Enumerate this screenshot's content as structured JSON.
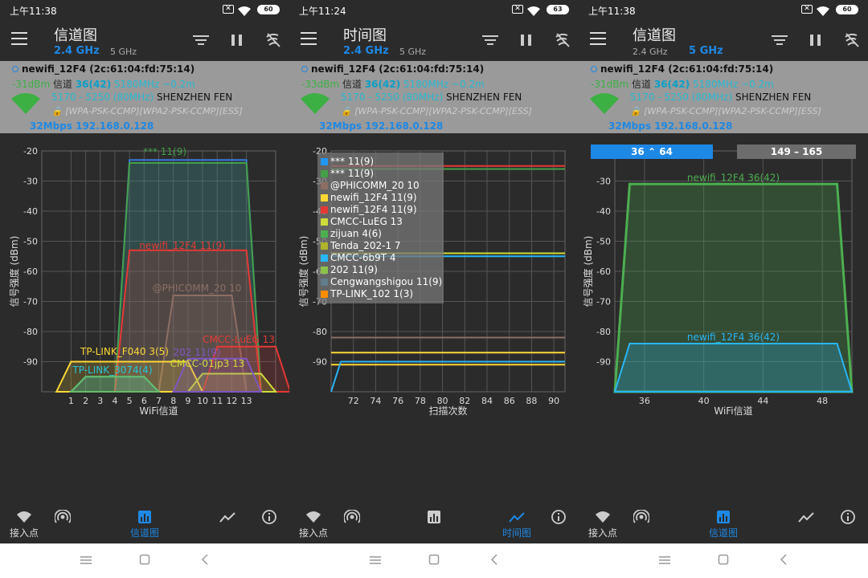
{
  "screens": [
    {
      "status_time": "上午11:38",
      "battery": "60",
      "title": "信道图",
      "band_left": "2.4 GHz",
      "band_right": "5 GHz",
      "active_band": "2.4",
      "ssid_line": "newifi_12F4 (2c:61:04:fd:75:14)",
      "signal": "-31dBm",
      "channel_label": "信道",
      "channel": "36(42)",
      "freq": "5180MHz ~0.2m",
      "range": "5170 - 5250 (80MHz)",
      "vendor": "SHENZHEN FEN",
      "security": "[WPA-PSK-CCMP][WPA2-PSK-CCMP][ESS]",
      "speed_ip": "32Mbps 192.168.0.128",
      "nav": [
        "接入点",
        "",
        "信道图",
        "",
        ""
      ],
      "nav_active": 2
    },
    {
      "status_time": "上午11:24",
      "battery": "63",
      "title": "时间图",
      "band_left": "2.4 GHz",
      "band_right": "5 GHz",
      "active_band": "2.4",
      "ssid_line": "newifi_12F4 (2c:61:04:fd:75:14)",
      "signal": "-33dBm",
      "channel_label": "信道",
      "channel": "36(42)",
      "freq": "5180MHz ~0.2m",
      "range": "5170 - 5250 (80MHz)",
      "vendor": "SHENZHEN FEN",
      "security": "[WPA-PSK-CCMP][WPA2-PSK-CCMP][ESS]",
      "speed_ip": "32Mbps 192.168.0.128",
      "nav": [
        "接入点",
        "",
        "",
        "时间图",
        ""
      ],
      "nav_active": 3
    },
    {
      "status_time": "上午11:38",
      "battery": "60",
      "title": "信道图",
      "band_left": "2.4 GHz",
      "band_right": "5 GHz",
      "active_band": "5",
      "ssid_line": "newifi_12F4 (2c:61:04:fd:75:14)",
      "signal": "-31dBm",
      "channel_label": "信道",
      "channel": "36(42)",
      "freq": "5180MHz ~0.2m",
      "range": "5170 - 5250 (80MHz)",
      "vendor": "SHENZHEN FEN",
      "security": "[WPA-PSK-CCMP][WPA2-PSK-CCMP][ESS]",
      "speed_ip": "32Mbps 192.168.0.128",
      "nav": [
        "接入点",
        "",
        "信道图",
        "",
        ""
      ],
      "nav_active": 2,
      "range_buttons": [
        "36",
        "64",
        "149 – 165"
      ]
    }
  ],
  "colors": {
    "accent": "#1e88e5",
    "background": "#2b2b2b",
    "info_panel": "#9a9a9a",
    "signal_green": "#3cb043",
    "cyan": "#27b8d2"
  },
  "chart_data": [
    {
      "type": "area",
      "ylabel": "信号强度 (dBm)",
      "xlabel": "WiFi信道",
      "ylim": [
        -100,
        -20
      ],
      "yticks": [
        -20,
        -30,
        -40,
        -50,
        -60,
        -70,
        -80,
        -90
      ],
      "xticks": [
        1,
        2,
        3,
        4,
        5,
        6,
        7,
        8,
        9,
        10,
        11,
        12,
        13
      ],
      "grid": true,
      "series": [
        {
          "name": "*** 11(9)",
          "center": 9,
          "width": 8,
          "dbm": -23,
          "color": "#3a78d8"
        },
        {
          "name": "*** 11(9)",
          "center": 9,
          "width": 8,
          "dbm": -24,
          "color": "#43a047"
        },
        {
          "name": "newifi_12F4 11(9)",
          "center": 9,
          "width": 8,
          "dbm": -53,
          "color": "#e53935"
        },
        {
          "name": "@PHICOMM_20 10",
          "center": 10,
          "width": 4,
          "dbm": -68,
          "color": "#8d6e63"
        },
        {
          "name": "CMCC-LuEG 13",
          "center": 13,
          "width": 4,
          "dbm": -85,
          "color": "#e53935"
        },
        {
          "name": "TP-LINK_F040 3(5)",
          "center": 5,
          "width": 8,
          "dbm": -90,
          "color": "#fdd835"
        },
        {
          "name": "TP-LINK_3074(4)",
          "center": 4,
          "width": 4,
          "dbm": -95,
          "color": "#26c6da"
        },
        {
          "name": "CMCC-01jp3 13",
          "center": 12,
          "width": 4,
          "dbm": -94,
          "color": "#cddc39"
        },
        {
          "name": "202 11(9)",
          "center": 11,
          "width": 4,
          "dbm": -89,
          "color": "#7e57c2"
        },
        {
          "name": "zijuan 4(6)",
          "center": 4,
          "width": 4,
          "dbm": -95,
          "color": "#66bb6a"
        }
      ],
      "labels": [
        "***",
        "11(9)",
        "newifi_12F4 11(9)",
        "@PHICOMM_20 10",
        "CMCC-LuEG 13",
        "TP-LINK_F040 3(5)",
        "TP-LINK_3074(4)",
        "CMCC-01jp3 13",
        "202 11(9)"
      ]
    },
    {
      "type": "line",
      "ylabel": "信号强度 (dBm)",
      "xlabel": "扫描次数",
      "ylim": [
        -100,
        -20
      ],
      "yticks": [
        -20,
        -30,
        -40,
        -50,
        -60,
        -70,
        -80,
        -90
      ],
      "xticks": [
        72,
        74,
        76,
        78,
        80,
        82,
        84,
        86,
        88,
        90
      ],
      "xlim": [
        70,
        91
      ],
      "grid": true,
      "series": [
        {
          "name": "*** 11(9)",
          "color": "#2196f3",
          "dbm": -100
        },
        {
          "name": "*** 11(9)",
          "color": "#43a047",
          "dbm": -26
        },
        {
          "name": "@PHICOMM_20 10",
          "color": "#8d6e63",
          "dbm": -82
        },
        {
          "name": "newifi_12F4 11(9)",
          "color": "#fdd835",
          "dbm": -87
        },
        {
          "name": "newifi_12F4 11(9)",
          "color": "#e53935",
          "dbm": -25
        },
        {
          "name": "CMCC-LuEG 13",
          "color": "#cddc39",
          "dbm": -54
        },
        {
          "name": "zijuan 4(6)",
          "color": "#4caf50",
          "dbm": -100
        },
        {
          "name": "Tenda_202-1 7",
          "color": "#afb42b",
          "dbm": -100
        },
        {
          "name": "CMCC-6b9T 4",
          "color": "#29b6f6",
          "dbm": -55
        },
        {
          "name": "202 11(9)",
          "color": "#8bc34a",
          "dbm": -100
        },
        {
          "name": "Cengwangshigou 11(9)",
          "color": "#607d8b",
          "dbm": -100
        },
        {
          "name": "TP-LINK_102 1(3)",
          "color": "#fb8c00",
          "dbm": -100
        }
      ],
      "extra_lines": [
        {
          "color": "#fdd835",
          "dbm": -91
        },
        {
          "color": "#29b6f6",
          "dbm": -90
        }
      ]
    },
    {
      "type": "area",
      "ylabel": "信号强度 (dBm)",
      "xlabel": "WiFi信道",
      "ylim": [
        -100,
        -20
      ],
      "yticks": [
        -20,
        -30,
        -40,
        -50,
        -60,
        -70,
        -80,
        -90
      ],
      "xticks": [
        36,
        40,
        44,
        48
      ],
      "xlim": [
        34,
        50
      ],
      "grid": true,
      "series": [
        {
          "name": "newifi_12F4 36(42)",
          "lo": 34,
          "hi": 50,
          "dbm": -31,
          "color": "#4caf50"
        },
        {
          "name": "newifi_12F4 36(42)",
          "lo": 34,
          "hi": 50,
          "dbm": -84,
          "color": "#29b6f6"
        }
      ]
    }
  ]
}
